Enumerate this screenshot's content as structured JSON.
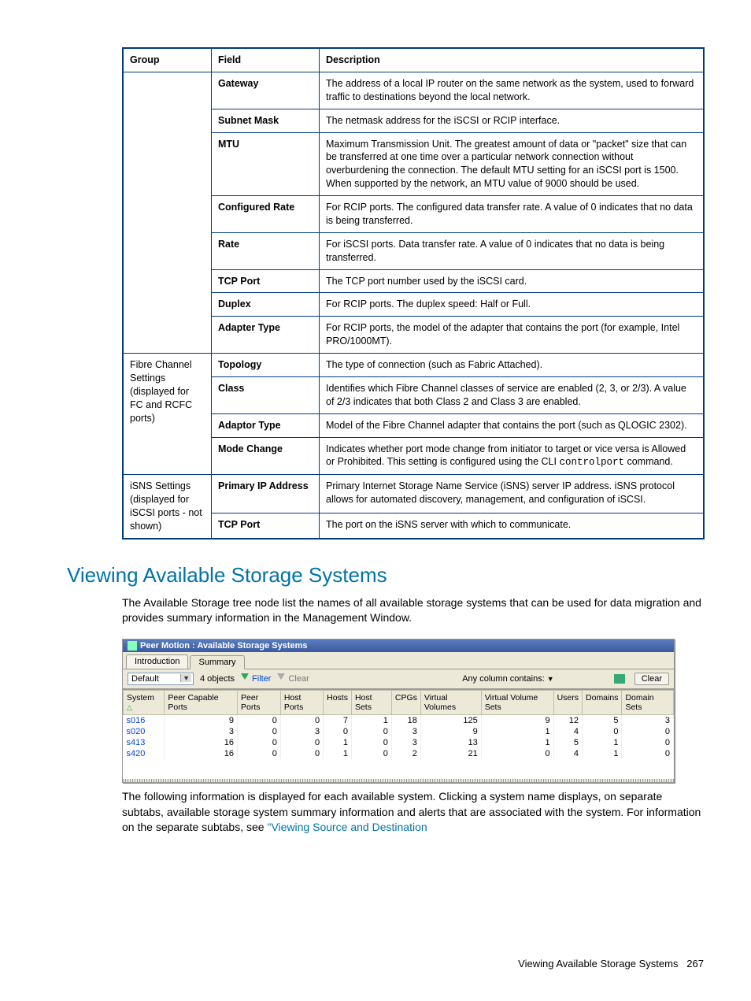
{
  "table": {
    "headers": [
      "Group",
      "Field",
      "Description"
    ],
    "rows": [
      {
        "group": "",
        "field": "Gateway",
        "desc": "The address of a local IP router on the same network as the system, used to forward traffic to destinations beyond the local network."
      },
      {
        "group": "",
        "field": "Subnet Mask",
        "desc": "The netmask address for the iSCSI or RCIP interface."
      },
      {
        "group": "",
        "field": "MTU",
        "desc": "Maximum Transmission Unit. The greatest amount of data or \"packet\" size that can be transferred at one time over a particular network connection without overburdening the connection. The default MTU setting for an iSCSI port is 1500. When supported by the network, an MTU value of 9000 should be used."
      },
      {
        "group": "",
        "field": "Configured Rate",
        "desc": "For RCIP ports. The configured data transfer rate. A value of 0 indicates that no data is being transferred."
      },
      {
        "group": "",
        "field": "Rate",
        "desc": "For iSCSI ports. Data transfer rate. A value of 0 indicates that no data is being transferred."
      },
      {
        "group": "",
        "field": "TCP Port",
        "desc": "The TCP port number used by the iSCSI card."
      },
      {
        "group": "",
        "field": "Duplex",
        "desc": "For RCIP ports. The duplex speed: Half or Full."
      },
      {
        "group": "",
        "field": "Adapter Type",
        "desc": "For RCIP ports, the model of the adapter that contains the port (for example, Intel PRO/1000MT)."
      },
      {
        "group": "Fibre Channel Settings (displayed for FC and RCFC ports)",
        "field": "Topology",
        "desc": "The type of connection (such as Fabric Attached)."
      },
      {
        "group": "",
        "field": "Class",
        "desc": "Identifies which Fibre Channel classes of service are enabled (2, 3, or 2/3). A value of 2/3 indicates that both Class 2 and Class 3 are enabled."
      },
      {
        "group": "",
        "field": "Adaptor Type",
        "desc": "Model of the Fibre Channel adapter that contains the port (such as QLOGIC 2302)."
      },
      {
        "group": "",
        "field": "Mode Change",
        "desc_pre": "Indicates whether port mode change from initiator to target or vice versa is Allowed or Prohibited. This setting is configured using the CLI ",
        "code": "controlport",
        "desc_post": " command."
      },
      {
        "group": "iSNS Settings (displayed for iSCSI ports - not shown)",
        "field": "Primary IP Address",
        "desc": "Primary Internet Storage Name Service (iSNS) server IP address. iSNS protocol allows for automated discovery, management, and configuration of iSCSI."
      },
      {
        "group": "",
        "field": "TCP Port",
        "desc": "The port on the iSNS server with which to communicate."
      }
    ]
  },
  "section_title": "Viewing Available Storage Systems",
  "para1": "The Available Storage tree node list the names of all available storage systems that can be used for data migration and provides summary information in the Management Window.",
  "para2_pre": "The following information is displayed for each available system. Clicking a system name displays, on separate subtabs, available storage system summary information and alerts that are associated with the system. For information on the separate subtabs, see ",
  "para2_link": "\"Viewing Source and Destination",
  "screenshot": {
    "title": "Peer Motion : Available Storage Systems",
    "tabs": [
      "Introduction",
      "Summary"
    ],
    "active_tab": 1,
    "dropdown_value": "Default",
    "objects_label": "4 objects",
    "filter_label": "Filter",
    "clear_label": "Clear",
    "col_contains_label": "Any column contains:",
    "clear_button": "Clear",
    "columns": [
      "System",
      "Peer Capable Ports",
      "Peer Ports",
      "Host Ports",
      "Hosts",
      "Host Sets",
      "CPGs",
      "Virtual Volumes",
      "Virtual Volume Sets",
      "Users",
      "Domains",
      "Domain Sets"
    ],
    "rows": [
      [
        "s016",
        "9",
        "0",
        "0",
        "7",
        "1",
        "18",
        "125",
        "9",
        "12",
        "5",
        "3"
      ],
      [
        "s020",
        "3",
        "0",
        "3",
        "0",
        "0",
        "3",
        "9",
        "1",
        "4",
        "0",
        "0"
      ],
      [
        "s413",
        "16",
        "0",
        "0",
        "1",
        "0",
        "3",
        "13",
        "1",
        "5",
        "1",
        "0"
      ],
      [
        "s420",
        "16",
        "0",
        "0",
        "1",
        "0",
        "2",
        "21",
        "0",
        "4",
        "1",
        "0"
      ]
    ]
  },
  "footer": {
    "text": "Viewing Available Storage Systems",
    "page": "267"
  }
}
